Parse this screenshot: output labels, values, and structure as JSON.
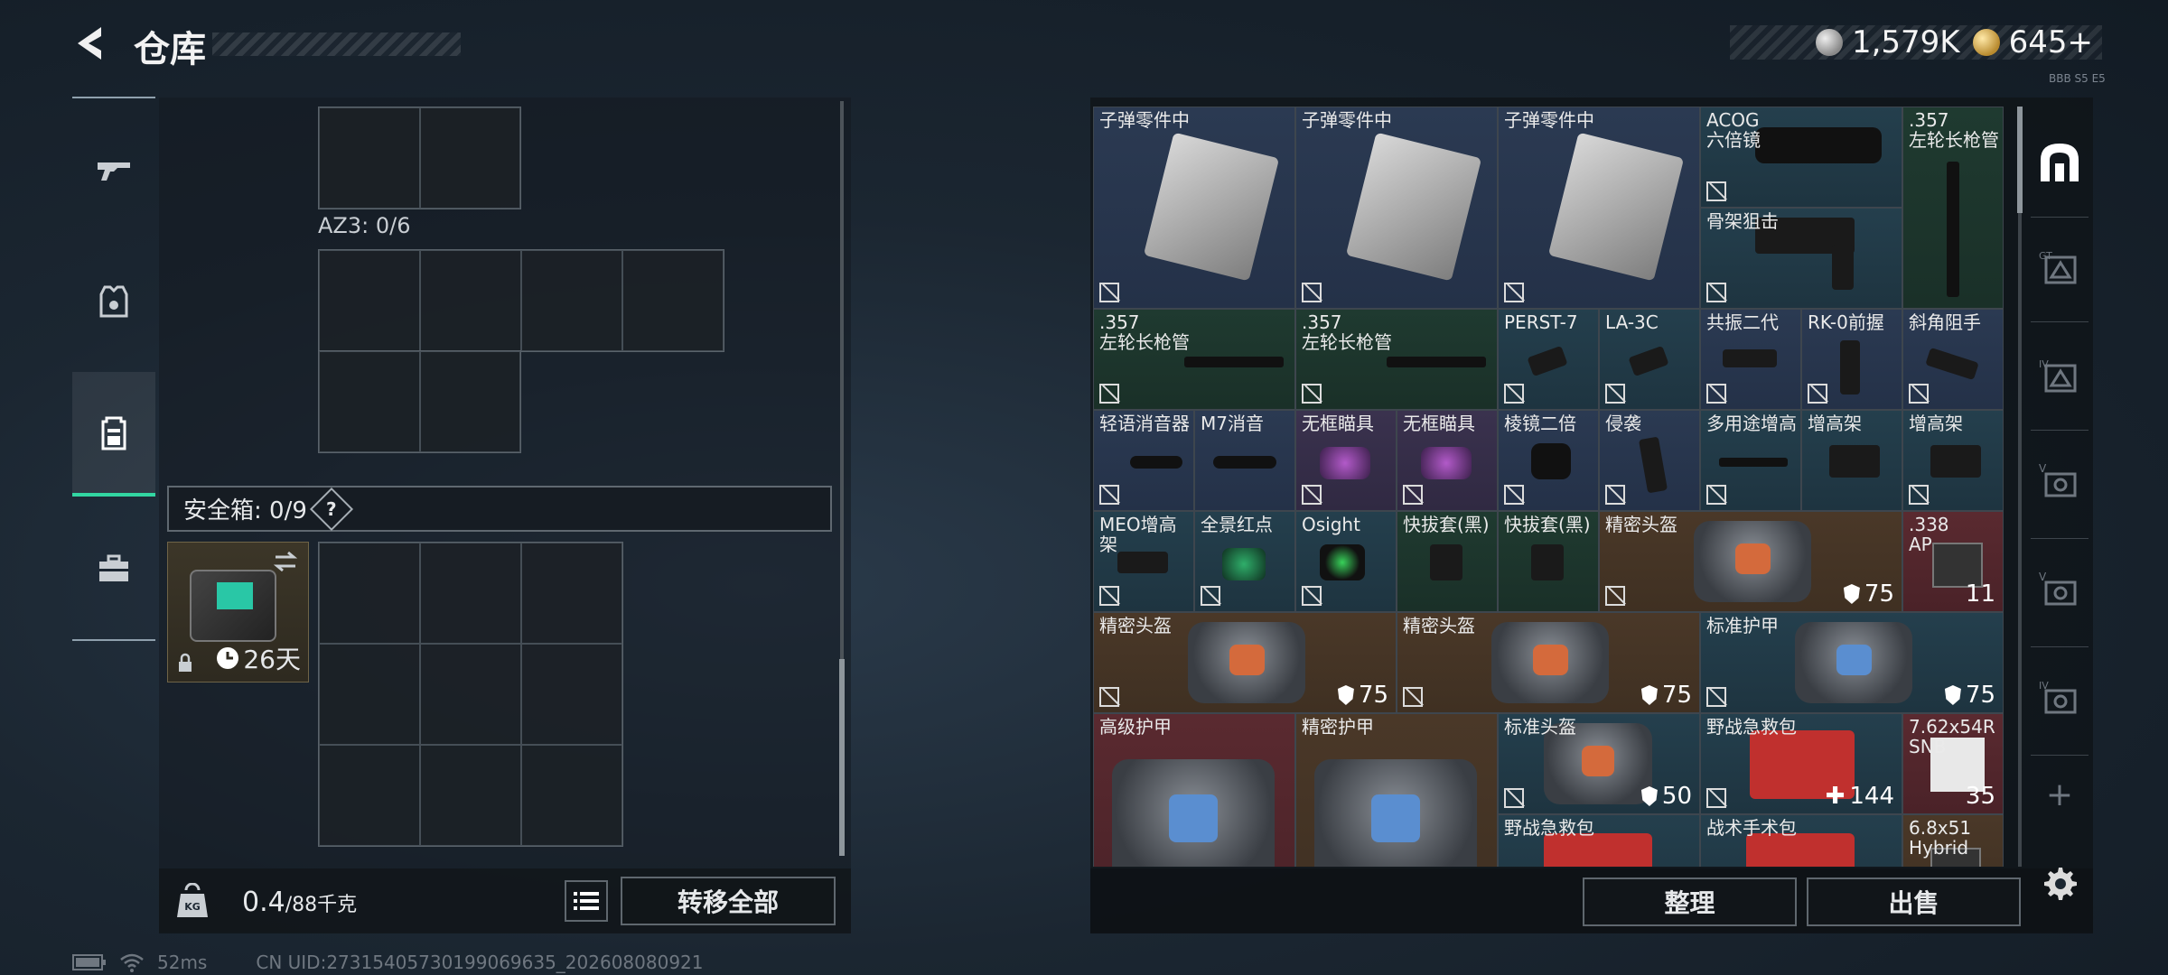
{
  "header": {
    "title": "仓库",
    "currency_primary": "1,579K",
    "currency_secondary": "645+",
    "version": "BBB S5 E5"
  },
  "left_nav": {
    "items": [
      "weapons",
      "ammo",
      "backpack-active",
      "toolbox"
    ]
  },
  "left_panel": {
    "az3_label": "AZ3: 0/6",
    "safe_label": "安全箱: 0/9",
    "safe_help": "?",
    "safe_item_duration": "26天",
    "weight_value": "0.4",
    "weight_unit": "/88千克",
    "transfer_all": "转移全部"
  },
  "status": {
    "ping": "52ms",
    "uid": "CN UID:27315405730199069635_202608080921"
  },
  "inventory": {
    "items": [
      {
        "name": "子弹零件中",
        "color": "blue",
        "stat": ""
      },
      {
        "name": "子弹零件中",
        "color": "blue",
        "stat": ""
      },
      {
        "name": "子弹零件中",
        "color": "blue",
        "stat": ""
      },
      {
        "name": "ACOG\n六倍镜",
        "color": "teal",
        "stat": ""
      },
      {
        "name": ".357\n左轮长枪管",
        "color": "green",
        "stat": ""
      },
      {
        "name": "骨架狙击",
        "color": "teal",
        "stat": ""
      },
      {
        "name": ".357\n左轮长枪管",
        "color": "green",
        "stat": ""
      },
      {
        "name": ".357\n左轮长枪管",
        "color": "green",
        "stat": ""
      },
      {
        "name": "PERST-7",
        "color": "teal",
        "stat": ""
      },
      {
        "name": "LA-3C",
        "color": "teal",
        "stat": ""
      },
      {
        "name": "共振二代",
        "color": "blue",
        "stat": ""
      },
      {
        "name": "RK-0前握",
        "color": "blue",
        "stat": ""
      },
      {
        "name": "斜角阻手",
        "color": "blue",
        "stat": ""
      },
      {
        "name": "轻语消音器",
        "color": "blue",
        "stat": ""
      },
      {
        "name": "M7消音",
        "color": "blue",
        "stat": ""
      },
      {
        "name": "无框瞄具",
        "color": "purple",
        "stat": ""
      },
      {
        "name": "无框瞄具",
        "color": "purple",
        "stat": ""
      },
      {
        "name": "棱镜二倍",
        "color": "blue",
        "stat": ""
      },
      {
        "name": "侵袭",
        "color": "blue",
        "stat": ""
      },
      {
        "name": "多用途增高",
        "color": "teal",
        "stat": ""
      },
      {
        "name": "增高架",
        "color": "teal",
        "stat": ""
      },
      {
        "name": "增高架",
        "color": "teal",
        "stat": ""
      },
      {
        "name": "MEO增高架",
        "color": "teal",
        "stat": ""
      },
      {
        "name": "全景红点",
        "color": "teal",
        "stat": ""
      },
      {
        "name": "Osight",
        "color": "teal",
        "stat": ""
      },
      {
        "name": "快拔套(黑)",
        "color": "green",
        "stat": ""
      },
      {
        "name": "快拔套(黑)",
        "color": "green",
        "stat": ""
      },
      {
        "name": "精密头盔",
        "color": "brown",
        "stat": "75"
      },
      {
        "name": ".338\nAP",
        "color": "red",
        "stat": "11"
      },
      {
        "name": "精密头盔",
        "color": "brown",
        "stat": "75"
      },
      {
        "name": "精密头盔",
        "color": "brown",
        "stat": "75"
      },
      {
        "name": "标准护甲",
        "color": "teal",
        "stat": "75"
      },
      {
        "name": "高级护甲",
        "color": "red",
        "stat": ""
      },
      {
        "name": "精密护甲",
        "color": "brown",
        "stat": ""
      },
      {
        "name": "标准头盔",
        "color": "teal",
        "stat": "50"
      },
      {
        "name": "野战急救包",
        "color": "teal",
        "stat": "144"
      },
      {
        "name": "7.62x54R\nSNB",
        "color": "red",
        "stat": "35"
      },
      {
        "name": "野战急救包",
        "color": "teal",
        "stat": ""
      },
      {
        "name": "战术手术包",
        "color": "teal",
        "stat": ""
      },
      {
        "name": "6.8x51\nHybrid",
        "color": "brown",
        "stat": ""
      }
    ]
  },
  "right_actions": {
    "sort": "整理",
    "sell": "出售"
  },
  "right_sidebar": {
    "tabs": [
      "home-tab",
      "gtv-tab-1",
      "gtv-tab-2",
      "v-tab-1",
      "v-tab-2",
      "v-tab-3"
    ],
    "add": "+"
  }
}
